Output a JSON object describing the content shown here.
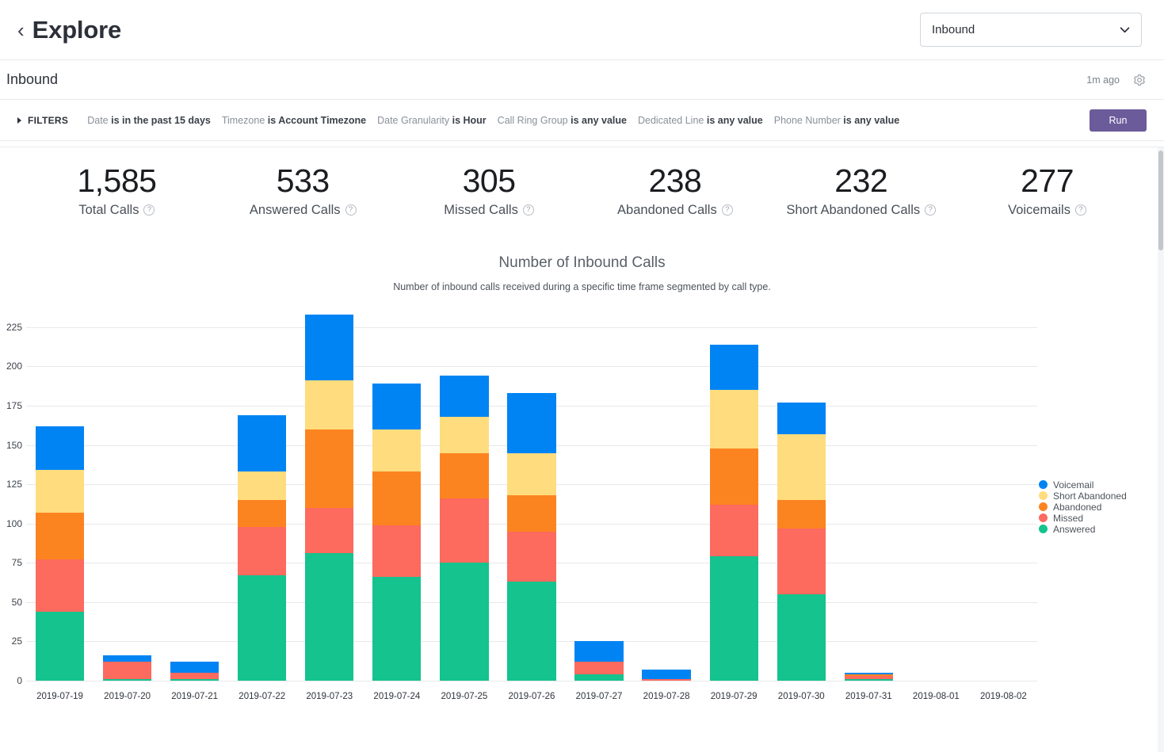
{
  "header": {
    "back_icon": "chevron-left-icon",
    "title": "Explore",
    "report_select": {
      "value": "Inbound",
      "caret_icon": "chevron-down-icon"
    }
  },
  "subheader": {
    "title": "Inbound",
    "updated": "1m ago",
    "settings_icon": "gear-icon"
  },
  "filters": {
    "toggle_label": "FILTERS",
    "items": [
      {
        "field": "Date",
        "condition": "is in the past 15 days"
      },
      {
        "field": "Timezone",
        "condition": "is Account Timezone"
      },
      {
        "field": "Date Granularity",
        "condition": "is Hour"
      },
      {
        "field": "Call Ring Group",
        "condition": "is any value"
      },
      {
        "field": "Dedicated Line",
        "condition": "is any value"
      },
      {
        "field": "Phone Number",
        "condition": "is any value"
      }
    ],
    "run_label": "Run",
    "run_color": "#6b5b9a"
  },
  "kpis": [
    {
      "value": "1,585",
      "label": "Total Calls",
      "help_icon": "question-mark-icon"
    },
    {
      "value": "533",
      "label": "Answered Calls",
      "help_icon": "question-mark-icon"
    },
    {
      "value": "305",
      "label": "Missed Calls",
      "help_icon": "question-mark-icon"
    },
    {
      "value": "238",
      "label": "Abandoned Calls",
      "help_icon": "question-mark-icon"
    },
    {
      "value": "232",
      "label": "Short Abandoned Calls",
      "help_icon": "question-mark-icon"
    },
    {
      "value": "277",
      "label": "Voicemails",
      "help_icon": "question-mark-icon"
    }
  ],
  "chart_data": {
    "type": "bar",
    "stacked": true,
    "title": "Number of Inbound Calls",
    "subtitle": "Number of inbound calls received during a specific time frame segmented by call type.",
    "xlabel": "",
    "ylabel": "",
    "ylim": [
      0,
      225
    ],
    "yticks": [
      0,
      25,
      50,
      75,
      100,
      125,
      150,
      175,
      200,
      225
    ],
    "grid": true,
    "legend_position": "right",
    "categories": [
      "2019-07-19",
      "2019-07-20",
      "2019-07-21",
      "2019-07-22",
      "2019-07-23",
      "2019-07-24",
      "2019-07-25",
      "2019-07-26",
      "2019-07-27",
      "2019-07-28",
      "2019-07-29",
      "2019-07-30",
      "2019-07-31",
      "2019-08-01",
      "2019-08-02"
    ],
    "series": [
      {
        "name": "Answered",
        "color": "#14c38e",
        "values": [
          44,
          1,
          1,
          67,
          81,
          66,
          75,
          63,
          4,
          0,
          79,
          55,
          1,
          0,
          0
        ]
      },
      {
        "name": "Missed",
        "color": "#fd6a5e",
        "values": [
          33,
          11,
          4,
          31,
          29,
          33,
          41,
          32,
          8,
          1,
          33,
          42,
          2,
          0,
          0
        ]
      },
      {
        "name": "Abandoned",
        "color": "#fc8420",
        "values": [
          30,
          0,
          0,
          17,
          50,
          34,
          29,
          23,
          0,
          0,
          36,
          18,
          1,
          0,
          0
        ]
      },
      {
        "name": "Short Abandoned",
        "color": "#ffdc7d",
        "values": [
          27,
          0,
          0,
          18,
          31,
          27,
          23,
          27,
          0,
          0,
          37,
          42,
          0,
          0,
          0
        ]
      },
      {
        "name": "Voicemail",
        "color": "#0084f4",
        "values": [
          28,
          4,
          7,
          36,
          42,
          29,
          26,
          38,
          13,
          6,
          29,
          20,
          1,
          0,
          0
        ]
      }
    ],
    "legend": [
      {
        "name": "Voicemail",
        "color": "#0084f4"
      },
      {
        "name": "Short Abandoned",
        "color": "#ffdc7d"
      },
      {
        "name": "Abandoned",
        "color": "#fc8420"
      },
      {
        "name": "Missed",
        "color": "#fd6a5e"
      },
      {
        "name": "Answered",
        "color": "#14c38e"
      }
    ]
  }
}
